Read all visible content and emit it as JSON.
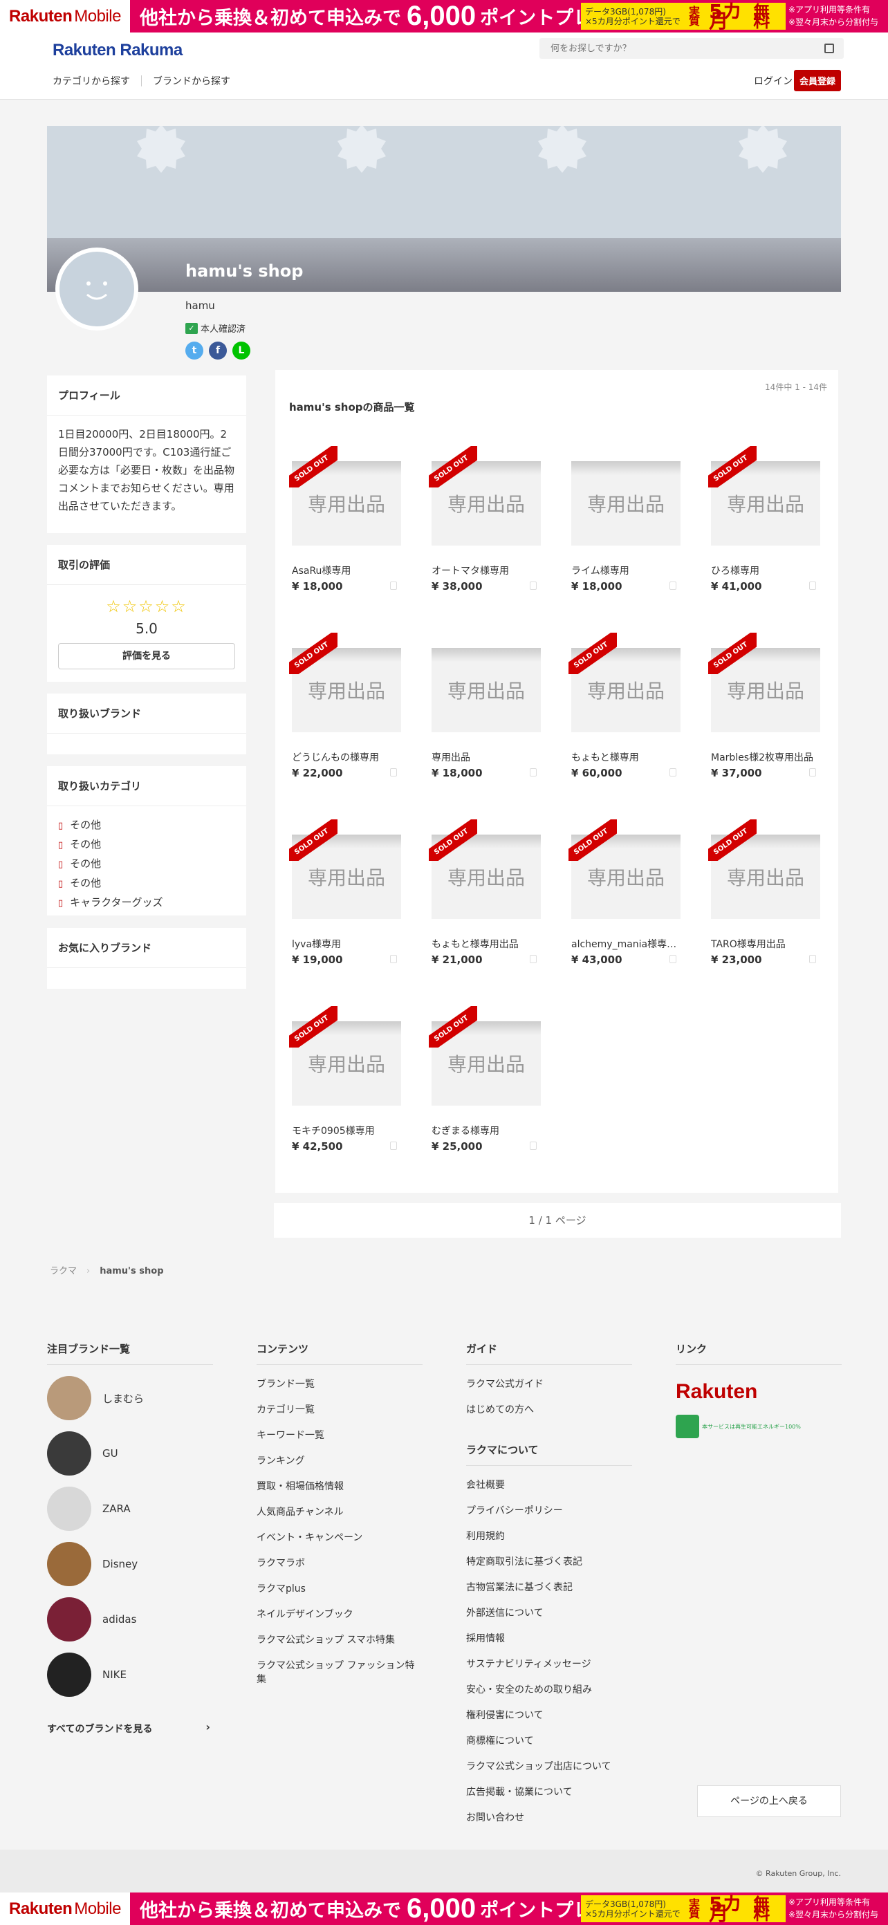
{
  "promo": {
    "logo_main": "Rakuten",
    "logo_sub": "Mobile",
    "headline": "他社から乗換＆初めて申込みで",
    "big_number": "6,000",
    "headline2": "ポイントプレゼント",
    "yellow_small_1": "データ3GB(1,078円)",
    "yellow_small_2": "×5カ月分ポイント還元で",
    "yellow_jisshitsu": "実質",
    "yellow_five": "5カ月",
    "yellow_muryou": "無料",
    "note_1": "※アプリ利用等条件有",
    "note_2": "※翌々月末から分割付与"
  },
  "header": {
    "brand_main": "Rakuten",
    "brand_sub": "Rakuma",
    "search_placeholder": "何をお探しですか？",
    "nav_category": "カテゴリから探す",
    "nav_brand": "ブランドから探す",
    "login": "ログイン",
    "register": "会員登録"
  },
  "shop": {
    "name": "hamu's shop",
    "owner": "hamu",
    "verified": "本人確認済",
    "share_twitter": "t",
    "share_facebook": "f",
    "share_line": "L"
  },
  "sidebar": {
    "profile_heading": "プロフィール",
    "profile_text": "1日目20000円、2日目18000円。2日間分37000円です。C103通行証ご必要な方は「必要日・枚数」を出品物コメントまでお知らせください。専用出品させていただきます。",
    "rating_heading": "取引の評価",
    "rating_stars": "☆☆☆☆☆",
    "rating_score": "5.0",
    "rating_button": "評価を見る",
    "brands_heading": "取り扱いブランド",
    "categories_heading": "取り扱いカテゴリ",
    "categories": [
      "その他",
      "その他",
      "その他",
      "その他",
      "キャラクターグッズ"
    ],
    "fav_brands_heading": "お気に入りブランド"
  },
  "products": {
    "count": "14件中 1 - 14件",
    "title": "hamu's shopの商品一覧",
    "thumb_label": "専用出品",
    "sold_label": "SOLD OUT",
    "items": [
      {
        "name": "AsaRu様専用",
        "price": "¥ 18,000",
        "sold": true
      },
      {
        "name": "オートマタ様専用",
        "price": "¥ 38,000",
        "sold": true
      },
      {
        "name": "ライム様専用",
        "price": "¥ 18,000",
        "sold": false
      },
      {
        "name": "ひろ様専用",
        "price": "¥ 41,000",
        "sold": true
      },
      {
        "name": "どうじんもの様専用",
        "price": "¥ 22,000",
        "sold": true
      },
      {
        "name": "専用出品",
        "price": "¥ 18,000",
        "sold": false
      },
      {
        "name": "もょもと様専用",
        "price": "¥ 60,000",
        "sold": true
      },
      {
        "name": "Marbles様2枚専用出品",
        "price": "¥ 37,000",
        "sold": true
      },
      {
        "name": "lyva様専用",
        "price": "¥ 19,000",
        "sold": true
      },
      {
        "name": "もょもと様専用出品",
        "price": "¥ 21,000",
        "sold": true
      },
      {
        "name": "alchemy_mania様専用出品",
        "price": "¥ 43,000",
        "sold": true
      },
      {
        "name": "TARO様専用出品",
        "price": "¥ 23,000",
        "sold": true
      },
      {
        "name": "モキチ0905様専用",
        "price": "¥ 42,500",
        "sold": true
      },
      {
        "name": "むぎまる様専用",
        "price": "¥ 25,000",
        "sold": true
      }
    ]
  },
  "pager": "1 / 1 ページ",
  "breadcrumb": {
    "home": "ラクマ",
    "sep": "›",
    "current": "hamu's shop"
  },
  "footer": {
    "brands_heading": "注目ブランド一覧",
    "brands": [
      {
        "name": "しまむら",
        "color": "#b99a7a"
      },
      {
        "name": "GU",
        "color": "#3a3a3a"
      },
      {
        "name": "ZARA",
        "color": "#d8d8d8"
      },
      {
        "name": "Disney",
        "color": "#9a6a3a"
      },
      {
        "name": "adidas",
        "color": "#7a2036"
      },
      {
        "name": "NIKE",
        "color": "#222222"
      }
    ],
    "all_brands": "すべてのブランドを見る",
    "all_brands_arrow": "›",
    "contents_heading": "コンテンツ",
    "contents": [
      "ブランド一覧",
      "カテゴリ一覧",
      "キーワード一覧",
      "ランキング",
      "買取・相場価格情報",
      "人気商品チャンネル",
      "イベント・キャンペーン",
      "ラクマラボ",
      "ラクマplus",
      "ネイルデザインブック",
      "ラクマ公式ショップ スマホ特集",
      "ラクマ公式ショップ ファッション特集"
    ],
    "guide_heading": "ガイド",
    "guide": [
      "ラクマ公式ガイド",
      "はじめての方へ"
    ],
    "about_heading": "ラクマについて",
    "about": [
      "会社概要",
      "プライバシーポリシー",
      "利用規約",
      "特定商取引法に基づく表記",
      "古物営業法に基づく表記",
      "外部送信について",
      "採用情報",
      "サステナビリティメッセージ",
      "安心・安全のための取り組み",
      "権利侵害について",
      "商標権について",
      "ラクマ公式ショップ出店について",
      "広告掲載・協業について",
      "お問い合わせ"
    ],
    "links_heading": "リンク",
    "rakuten_logo": "Rakuten",
    "green_text": "本サービスは再生可能エネルギー100%",
    "back_top": "ページの上へ戻る",
    "copyright": "© Rakuten Group, Inc."
  }
}
